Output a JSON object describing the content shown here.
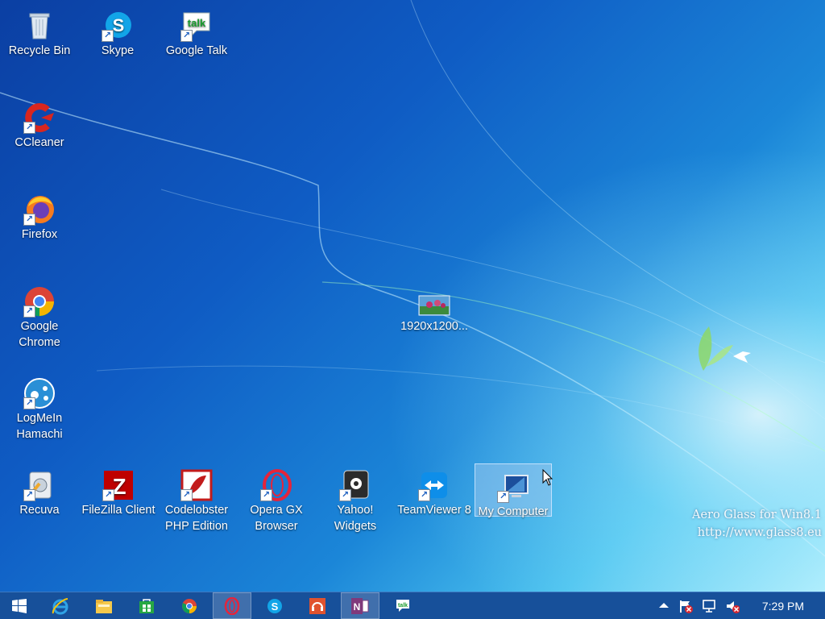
{
  "desktop": {
    "icons": [
      {
        "label": "Recycle Bin",
        "icon": "recycle-bin-icon"
      },
      {
        "label": "Skype",
        "icon": "skype-icon"
      },
      {
        "label": "Google Talk",
        "icon": "google-talk-icon"
      },
      {
        "label": "CCleaner",
        "icon": "ccleaner-icon"
      },
      {
        "label": "Firefox",
        "icon": "firefox-icon"
      },
      {
        "label": "Google Chrome",
        "icon": "chrome-icon"
      },
      {
        "label": "LogMeIn Hamachi",
        "icon": "hamachi-icon"
      },
      {
        "label": "Recuva",
        "icon": "recuva-icon"
      },
      {
        "label": "FileZilla Client",
        "icon": "filezilla-icon"
      },
      {
        "label": "Codelobster PHP Edition",
        "icon": "codelobster-icon"
      },
      {
        "label": "Opera GX Browser",
        "icon": "opera-gx-icon"
      },
      {
        "label": "Yahoo! Widgets",
        "icon": "yahoo-widgets-icon"
      },
      {
        "label": "TeamViewer 8",
        "icon": "teamviewer-icon"
      },
      {
        "label": "My Computer",
        "icon": "my-computer-icon",
        "selected": true
      },
      {
        "label": "1920x1200...",
        "icon": "image-file-icon"
      }
    ],
    "watermark": {
      "line1": "Aero Glass for Win8.1",
      "line2": "http://www.glass8.eu"
    }
  },
  "taskbar": {
    "buttons": [
      {
        "icon": "start-icon"
      },
      {
        "icon": "internet-explorer-icon"
      },
      {
        "icon": "file-explorer-icon"
      },
      {
        "icon": "store-icon"
      },
      {
        "icon": "chrome-icon"
      },
      {
        "icon": "opera-icon",
        "active": true
      },
      {
        "icon": "skype-icon"
      },
      {
        "icon": "music-app-icon"
      },
      {
        "icon": "onenote-icon",
        "active": true
      },
      {
        "icon": "google-talk-icon"
      }
    ],
    "tray": {
      "icons": [
        "show-hidden-icons-arrow",
        "action-center-flag-icon",
        "network-icon",
        "volume-muted-icon"
      ],
      "clock": "7:29 PM"
    }
  }
}
